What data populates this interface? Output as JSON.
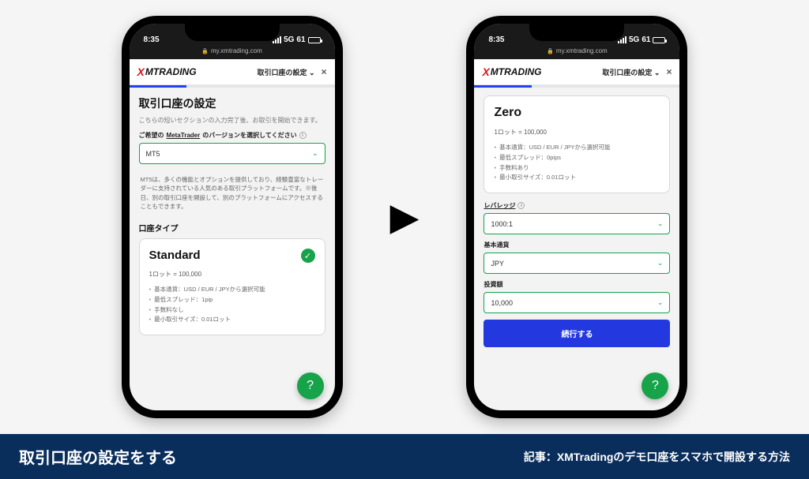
{
  "status": {
    "time": "8:35",
    "net": "5G",
    "battery": "61"
  },
  "url": "my.xmtrading.com",
  "header": {
    "brand_prefix": "X",
    "brand": "MTRADING",
    "menu": "取引口座の設定",
    "chev": "⌄",
    "close": "×"
  },
  "phone1": {
    "progress_pct": 28,
    "title": "取引口座の設定",
    "subtitle": "こちらの短いセクションの入力完了後、お取引を開始できます。",
    "mt_label_pre": "ご希望の",
    "mt_label_link": "MetaTrader",
    "mt_label_post": "のバージョンを選択してください",
    "mt_value": "MT5",
    "mt_desc": "MT5は、多くの機能とオプションを提供しており、経験豊富なトレーダーに支持されている人気のある取引プラットフォームです。※後日、別の取引口座を開設して、別のプラットフォームにアクセスすることもできます。",
    "account_section": "口座タイプ",
    "card": {
      "title": "Standard",
      "lot": "1ロット = 100,000",
      "bullets": [
        "基本通貨：USD / EUR / JPYから選択可能",
        "最低スプレッド：1pip",
        "手数料なし",
        "最小取引サイズ：0.01ロット"
      ]
    }
  },
  "phone2": {
    "progress_pct": 28,
    "card": {
      "title": "Zero",
      "lot": "1ロット = 100,000",
      "bullets": [
        "基本通貨：USD / EUR / JPYから選択可能",
        "最低スプレッド：0pips",
        "手数料あり",
        "最小取引サイズ：0.01ロット"
      ]
    },
    "leverage_label": "レバレッジ",
    "leverage_value": "1000:1",
    "currency_label": "基本通貨",
    "currency_value": "JPY",
    "amount_label": "投資額",
    "amount_value": "10,000",
    "continue": "続行する"
  },
  "fab": "?",
  "banner": {
    "left": "取引口座の設定をする",
    "right": "記事：XMTradingのデモ口座をスマホで開設する方法"
  }
}
